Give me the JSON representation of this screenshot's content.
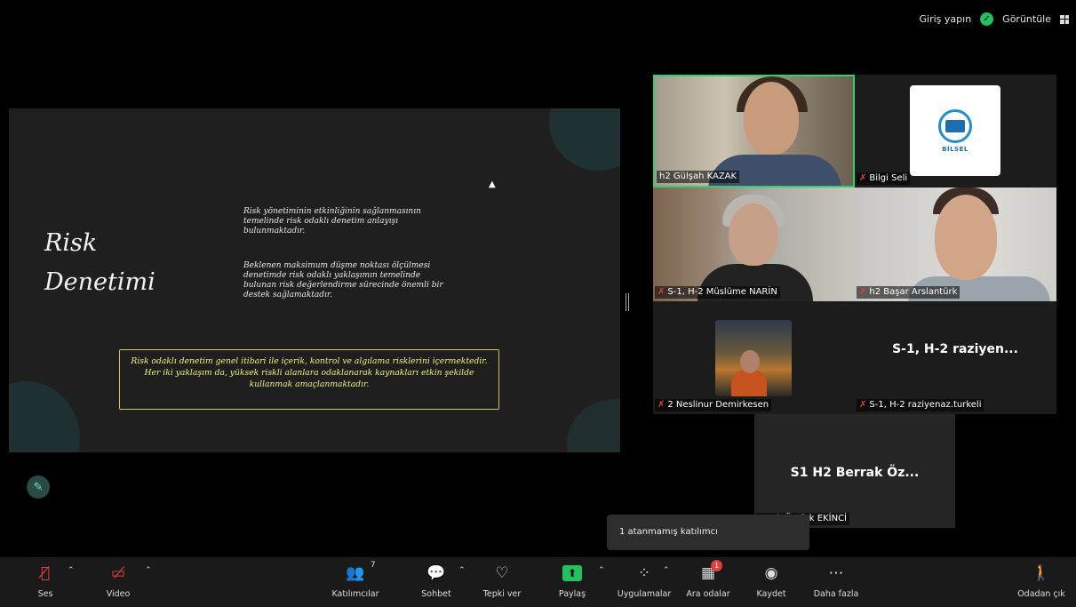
{
  "topbar": {
    "signin_label": "Giriş yapın",
    "view_label": "Görüntüle"
  },
  "slide": {
    "title_line1": "Risk",
    "title_line2": "Denetimi",
    "para1": "Risk yönetiminin etkinliğinin sağlanmasının temelinde risk odaklı denetim anlayışı bulunmaktadır.",
    "para2": "Beklenen maksimum düşme noktası ölçülmesi denetimde risk odaklı yaklaşımın temelinde bulunan risk değerlendirme sürecinde önemli bir destek sağlamaktadır.",
    "box": "Risk odaklı denetim genel itibari ile içerik, kontrol ve algılama risklerini içermektedir. Her iki yaklaşım da, yüksek riskli alanlara odaklanarak kaynakları etkin şekilde kullanmak amaçlanmaktadır."
  },
  "gallery": {
    "tiles": [
      {
        "label": "h2 Gülşah KAZAK",
        "muted": false
      },
      {
        "label": "Bilgi Seli",
        "muted": true,
        "logo_text": "BİLSEL"
      },
      {
        "label": "S-1, H-2 Müslüme NARİN",
        "muted": true
      },
      {
        "label": "h2 Başar Arslantürk",
        "muted": true
      },
      {
        "label": "2 Neslinur Demirkesen",
        "muted": true
      },
      {
        "label": "S-1, H-2 raziyenaz.turkeli",
        "muted": true,
        "display_name": "S-1, H-2 raziyen..."
      },
      {
        "label": "errak Öztürk EKİNCİ",
        "muted": false,
        "display_name": "S1 H2 Berrak Öz..."
      }
    ]
  },
  "tooltip": {
    "text": "1 atanmamış katılımcı"
  },
  "toolbar": {
    "audio": "Ses",
    "video": "Video",
    "participants": "Katılımcılar",
    "participants_count": "7",
    "chat": "Sohbet",
    "react": "Tepki ver",
    "share": "Paylaş",
    "apps": "Uygulamalar",
    "breakout": "Ara odalar",
    "breakout_badge": "1",
    "record": "Kaydet",
    "more": "Daha fazla",
    "leave": "Odadan çık"
  },
  "colors": {
    "active_speaker": "#2fd16f",
    "muted_mic": "#e0403a",
    "share_green": "#22c35e"
  }
}
